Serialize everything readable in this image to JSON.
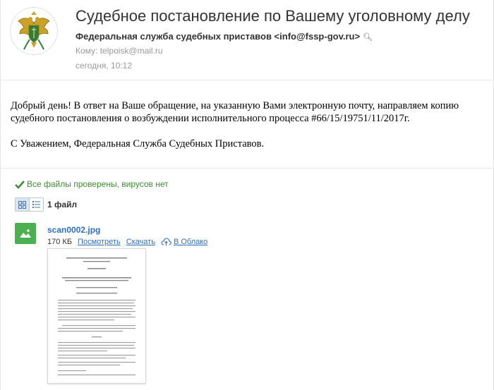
{
  "email": {
    "subject": "Судебное постановление по Вашему уголовному делу",
    "sender": "Федеральная служба судебных приставов <info@fssp-gov.ru>",
    "to": "Кому: telpoisk@mail.ru",
    "date": "сегодня, 10:12",
    "body": {
      "paragraph": "Добрый день! В ответ на Ваше обращение, на указанную Вами электронную почту, направляем копию судебного постановления о возбуждении исполнительного процесса #66/15/19751/11/2017г.",
      "signature": "С Уважением, Федеральная Служба Судебных Приставов."
    }
  },
  "attachments": {
    "virus_status": "Все файлы проверены, вирусов нет",
    "count": "1 файл",
    "file": {
      "name": "scan0002.jpg",
      "size": "170 КБ",
      "view_label": "Посмотреть",
      "download_label": "Скачать",
      "cloud_label": "В Облако"
    }
  },
  "colors": {
    "link": "#2d6fbf",
    "success": "#3a8f2e",
    "file_icon": "#4cb050"
  },
  "icons": [
    "emblem-avatar",
    "search-icon",
    "check-icon",
    "grid-view-icon",
    "list-view-icon",
    "image-file-icon",
    "cloud-upload-icon"
  ]
}
